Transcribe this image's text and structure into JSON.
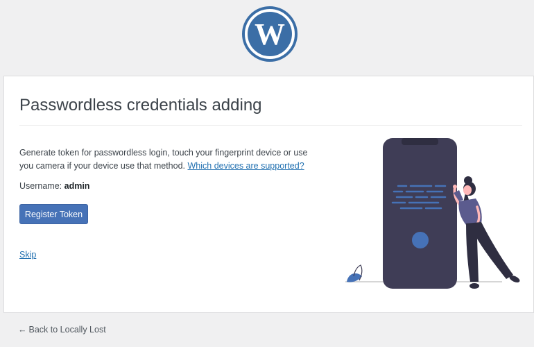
{
  "branding": {
    "logo_icon": "wordpress-logo-icon",
    "logo_color": "#3b6ea6"
  },
  "card": {
    "title": "Passwordless credentials adding",
    "description_text": "Generate token for passwordless login, touch your fingerprint device or use you camera if your device use that method.",
    "devices_link_label": "Which devices are supported?",
    "username_label": "Username:",
    "username_value": "admin",
    "register_button_label": "Register Token",
    "skip_label": "Skip",
    "illustration_icon": "woman-with-phone-illustration"
  },
  "footer": {
    "back_arrow": "←",
    "back_link_label": "Back to Locally Lost"
  },
  "colors": {
    "accent": "#2271b1",
    "button": "#4672b7",
    "phone_body": "#3f3d56",
    "illustration_accent": "#4672b7",
    "background": "#f0f0f1"
  }
}
